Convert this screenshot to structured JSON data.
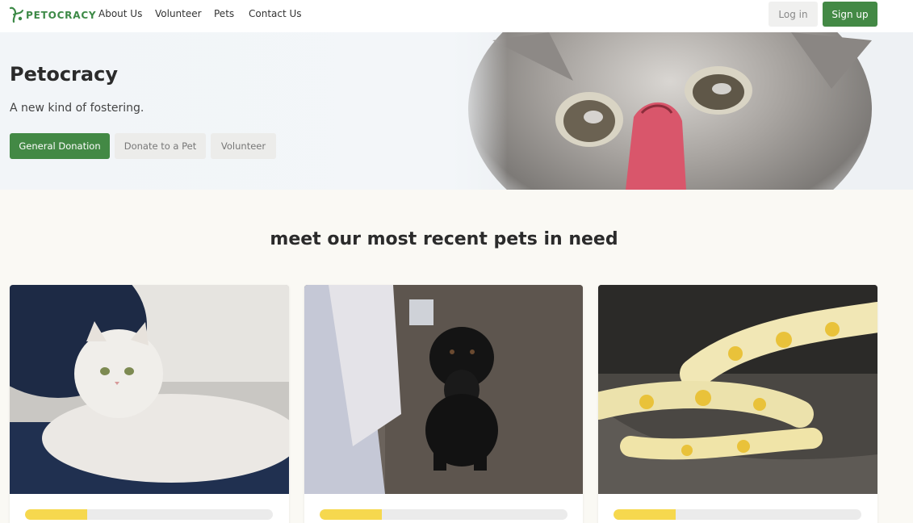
{
  "nav": {
    "logo_text": "PETOCRACY",
    "links": [
      "About Us",
      "Volunteer",
      "Pets",
      "Contact Us"
    ],
    "login_label": "Log in",
    "signup_label": "Sign up"
  },
  "hero": {
    "title": "Petocracy",
    "subtitle": "A new kind of fostering.",
    "buttons": [
      "General Donation",
      "Donate to a Pet",
      "Volunteer"
    ]
  },
  "section": {
    "title": "meet our most recent pets in need"
  },
  "pets": [
    {
      "animal": "cat",
      "progress_fraction": 0.25
    },
    {
      "animal": "dog",
      "progress_fraction": 0.25
    },
    {
      "animal": "snake",
      "progress_fraction": 0.25
    }
  ],
  "colors": {
    "primary_green": "#438945",
    "progress_yellow": "#f6d84e",
    "progress_track": "#ebebeb",
    "page_bg": "#faf9f4"
  }
}
